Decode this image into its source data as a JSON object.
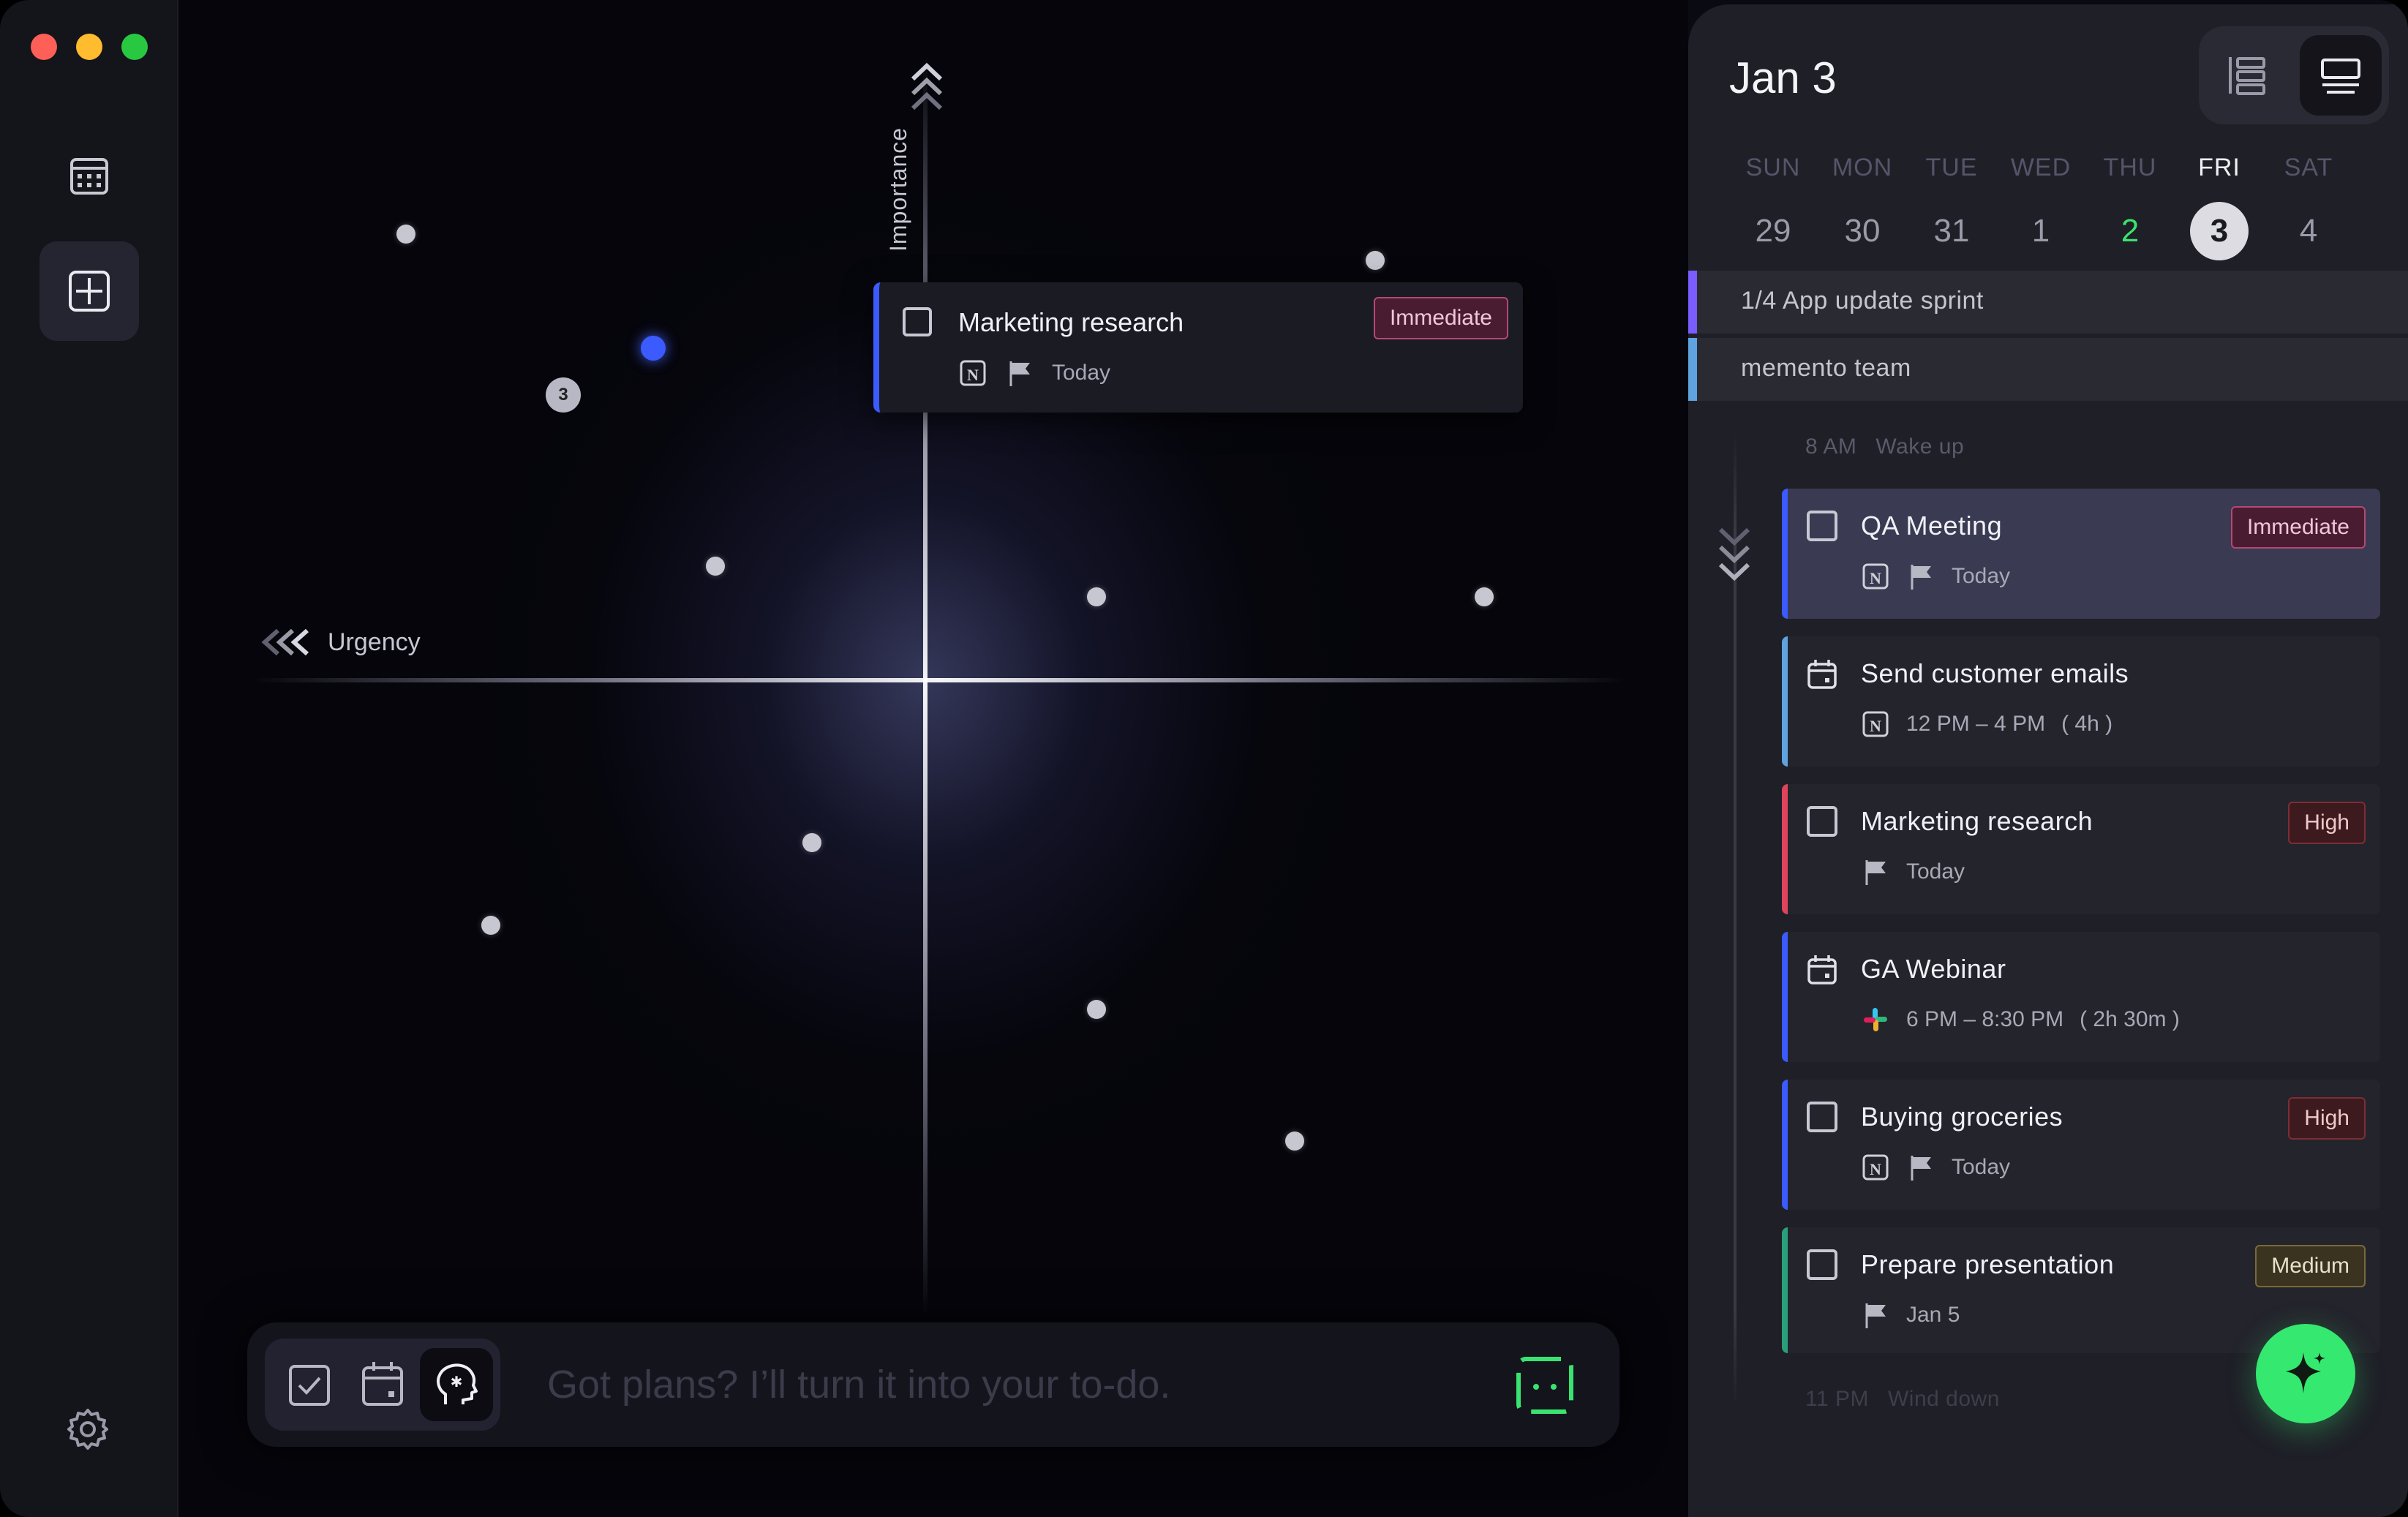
{
  "matrix": {
    "y_axis_label": "Importance",
    "x_axis_label": "Urgency",
    "cluster_count": "3",
    "popup": {
      "title": "Marketing research",
      "badge": "Immediate",
      "due": "Today"
    }
  },
  "prompt": {
    "placeholder": "Got plans? I’ll turn it into your to-do."
  },
  "panel": {
    "date_title": "Jan 3",
    "week": [
      {
        "name": "SUN",
        "date": "29"
      },
      {
        "name": "MON",
        "date": "30"
      },
      {
        "name": "TUE",
        "date": "31"
      },
      {
        "name": "WED",
        "date": "1"
      },
      {
        "name": "THU",
        "date": "2"
      },
      {
        "name": "FRI",
        "date": "3"
      },
      {
        "name": "SAT",
        "date": "4"
      }
    ],
    "all_day": [
      {
        "text": "1/4 App update sprint",
        "color": "#7b5cff"
      },
      {
        "text": "memento team",
        "color": "#5fa3e0"
      }
    ],
    "wake": {
      "time": "8 AM",
      "label": "Wake up"
    },
    "wind": {
      "time": "11 PM",
      "label": "Wind down"
    },
    "tasks": [
      {
        "title": "QA Meeting",
        "badge": "Immediate",
        "meta": "Today",
        "color": "#3b5bff"
      },
      {
        "title": "Send customer emails",
        "meta": "12 PM – 4 PM",
        "duration": "( 4h )",
        "color": "#5fa3e0"
      },
      {
        "title": "Marketing research",
        "badge": "High",
        "meta": "Today",
        "color": "#e0445c"
      },
      {
        "title": "GA Webinar",
        "meta": "6 PM – 8:30 PM",
        "duration": "( 2h 30m )",
        "color": "#3b5bff"
      },
      {
        "title": "Buying groceries",
        "badge": "High",
        "meta": "Today",
        "color": "#3b5bff"
      },
      {
        "title": "Prepare presentation",
        "badge": "Medium",
        "meta": "Jan 5",
        "color": "#2aa07a"
      }
    ]
  },
  "colors": {
    "accent_blue": "#3b5bff",
    "accent_green": "#35e86f",
    "today_green": "#39e36f"
  }
}
